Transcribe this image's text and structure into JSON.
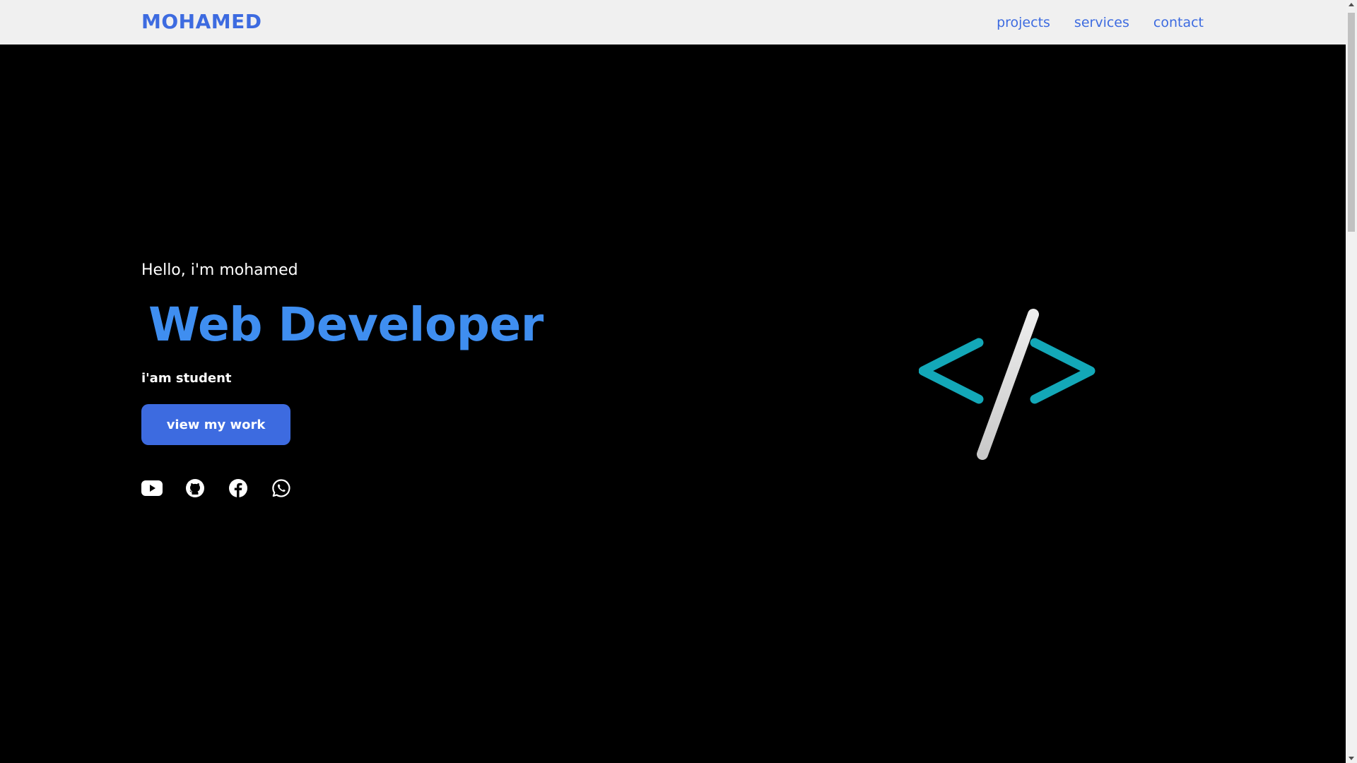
{
  "header": {
    "logo": "MOHAMED",
    "nav": [
      {
        "label": "projects"
      },
      {
        "label": "services"
      },
      {
        "label": "contact"
      }
    ]
  },
  "hero": {
    "greeting": "Hello, i'm mohamed",
    "role": "Web Developer",
    "subtitle": "i'am student",
    "cta_label": "view my work",
    "socials": [
      {
        "icon": "youtube-icon"
      },
      {
        "icon": "github-icon"
      },
      {
        "icon": "facebook-icon"
      },
      {
        "icon": "whatsapp-icon"
      }
    ],
    "illustration": "code-brackets-icon"
  },
  "colors": {
    "accent": "#3d6be0",
    "role_text": "#3f8ef0",
    "bracket": "#13a8b8",
    "slash": "#d9d9d9",
    "background": "#000000",
    "navbar": "#f0f0f0"
  }
}
